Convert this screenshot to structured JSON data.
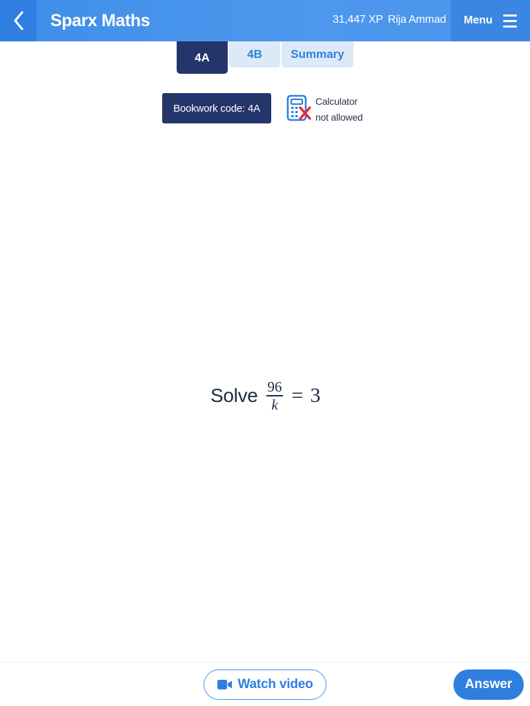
{
  "header": {
    "title": "Sparx Maths",
    "xp": "31,447 XP",
    "user": "Rija Ammad",
    "menu_label": "Menu"
  },
  "tabs": [
    {
      "label": "4A",
      "active": true
    },
    {
      "label": "4B",
      "active": false
    },
    {
      "label": "Summary",
      "active": false
    }
  ],
  "bookwork": {
    "label": "Bookwork code: 4A"
  },
  "calculator": {
    "line1": "Calculator",
    "line2": "not allowed",
    "icon": "calculator-not-allowed-icon"
  },
  "question": {
    "prefix": "Solve",
    "numerator": "96",
    "denominator": "k",
    "equals": "=",
    "rhs": "3"
  },
  "footer": {
    "watch_video": "Watch video",
    "answer": "Answer"
  },
  "colors": {
    "brand_blue": "#3f8ee8",
    "navy": "#24356b",
    "tab_inactive_bg": "#dce9f6",
    "error_red": "#e8253c"
  }
}
